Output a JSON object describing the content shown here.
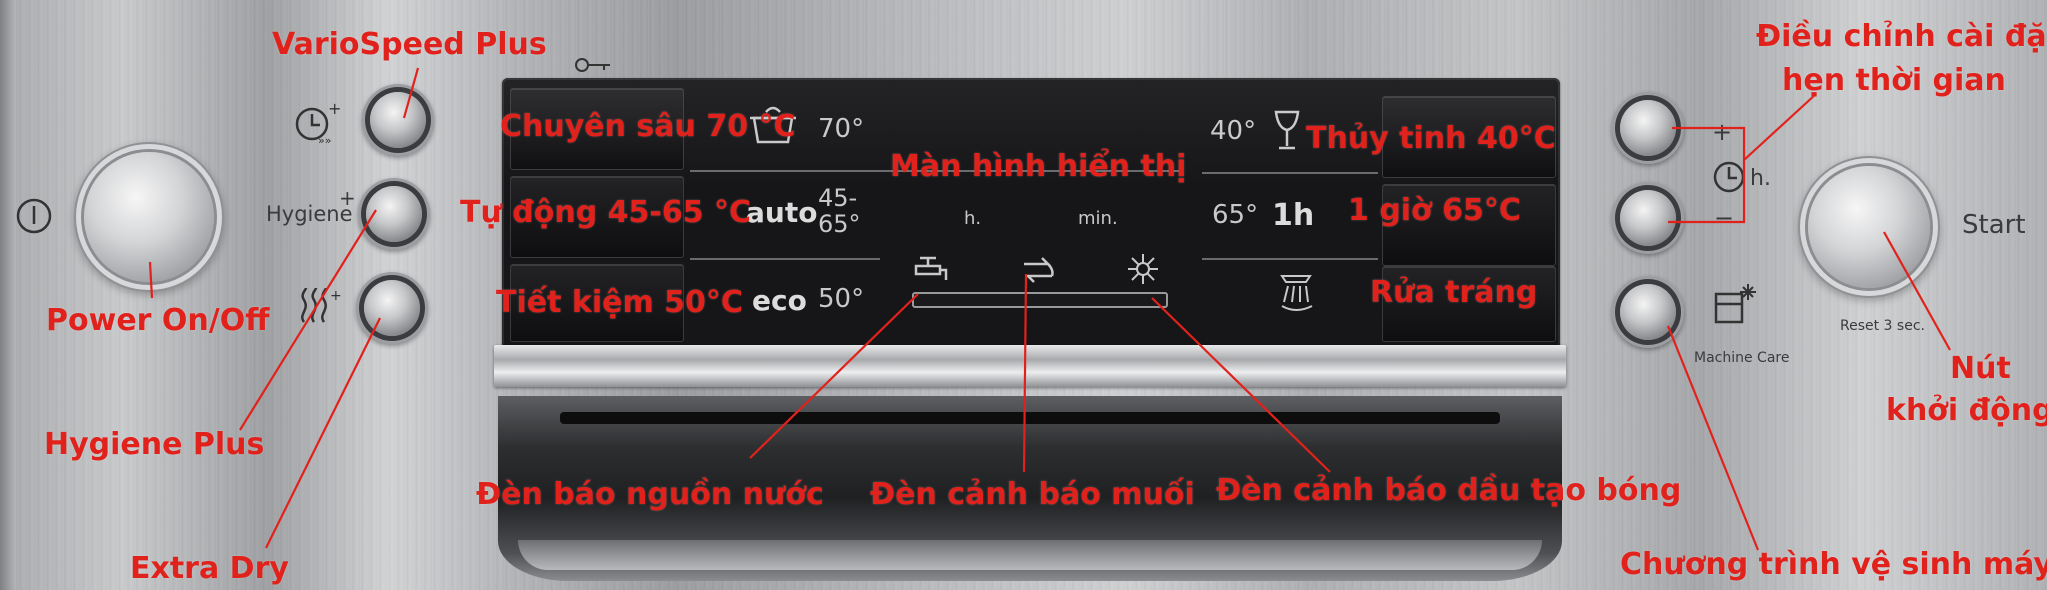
{
  "annotations": {
    "varioSpeed": "VarioSpeed Plus",
    "powerOnOff": "Power On/Off",
    "hygienePlus": "Hygiene Plus",
    "extraDry": "Extra Dry",
    "intensive": "Chuyên sâu 70 °C",
    "auto": "Tự động 45-65 °C",
    "eco": "Tiết kiệm 50°C",
    "display": "Màn hình hiển thị",
    "glass": "Thủy tinh 40°C",
    "oneHour": "1 giờ 65°C",
    "rinse": "Rửa tráng",
    "timerAdjustLine1": "Điều chỉnh cài đặt",
    "timerAdjustLine2": "hẹn thời gian",
    "startButtonLine1": "Nút",
    "startButtonLine2": "khởi động",
    "waterIndicator": "Đèn báo nguồn nước",
    "saltWarning": "Đèn cảnh báo muối",
    "rinseAidWarning": "Đèn cảnh báo dầu tạo bóng",
    "machineCareProgram": "Chương trình vệ sinh máy"
  },
  "panel": {
    "hygieneLabel": "Hygiene",
    "plus": "+",
    "minus": "−",
    "hoursLabel": "h.",
    "startLabel": "Start",
    "resetLabel": "Reset 3 sec.",
    "machineCareLabel": "Machine Care"
  },
  "display": {
    "intensiveTemp": "70°",
    "autoWord": "auto",
    "autoTempHigh": "45-",
    "autoTempLow": "65°",
    "ecoWord": "eco",
    "ecoTemp": "50°",
    "glassTemp": "40°",
    "oneHourTemp": "65°",
    "oneHourLabel": "1h",
    "hoursUnit": "h.",
    "minutesUnit": "min."
  },
  "colors": {
    "annotation": "#e1221c",
    "display_background": "#161618",
    "display_text": "#c8c8c8"
  }
}
